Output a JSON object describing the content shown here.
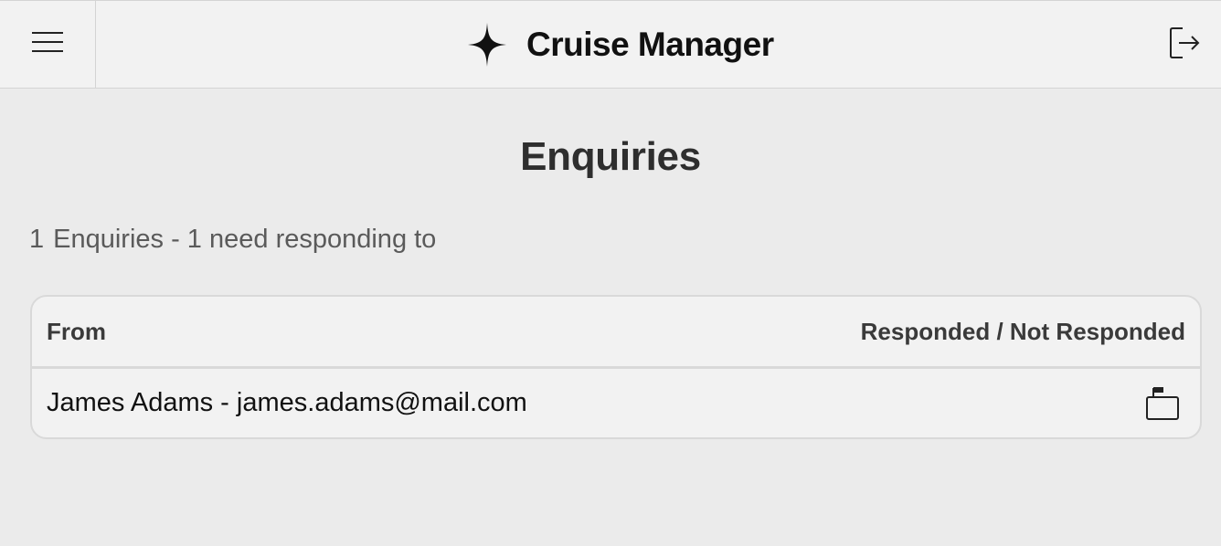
{
  "header": {
    "app_title": "Cruise Manager",
    "menu_icon": "hamburger-menu-icon",
    "brand_icon": "sparkle-star-icon",
    "logout_icon": "logout-icon"
  },
  "page": {
    "title": "Enquiries",
    "summary": {
      "count": "1",
      "text": "Enquiries - 1 need responding to"
    }
  },
  "table": {
    "columns": {
      "from": "From",
      "status": "Responded / Not Responded"
    },
    "rows": [
      {
        "from": "James Adams - james.adams@mail.com",
        "status_icon": "mailbox-flag-icon",
        "responded": false
      }
    ]
  },
  "colors": {
    "header_bg": "#f2f2f2",
    "page_bg": "#ebebeb",
    "border": "#d9d9d9",
    "text_primary": "#111111",
    "text_muted": "#5a5a5a"
  }
}
